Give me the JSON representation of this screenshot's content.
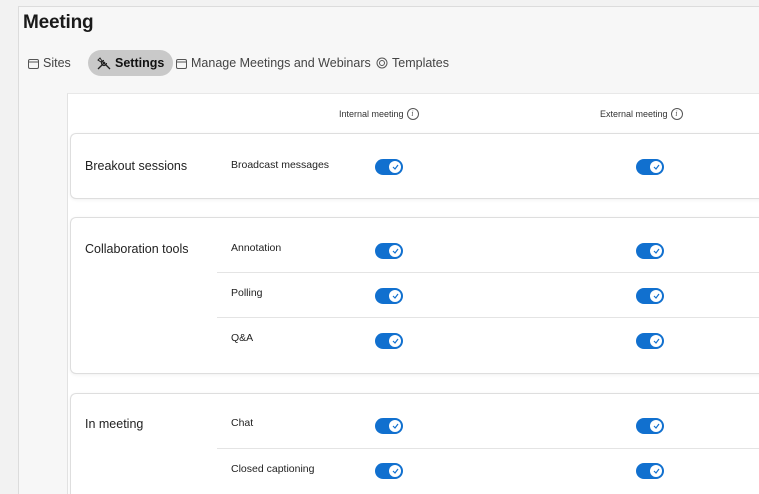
{
  "page_title": "Meeting",
  "tabs": [
    {
      "label": "Sites",
      "icon": "calendar-icon",
      "active": false
    },
    {
      "label": "Settings",
      "icon": "tools-icon",
      "active": true
    },
    {
      "label": "Manage Meetings and Webinars",
      "icon": "calendar-icon",
      "active": false
    },
    {
      "label": "Templates",
      "icon": "template-icon",
      "active": false
    }
  ],
  "columns": {
    "internal": "Internal meeting",
    "external": "External meeting"
  },
  "groups": [
    {
      "label": "Breakout sessions",
      "settings": [
        {
          "label": "Broadcast messages",
          "internal": true,
          "external": true
        }
      ]
    },
    {
      "label": "Collaboration tools",
      "settings": [
        {
          "label": "Annotation",
          "internal": true,
          "external": true
        },
        {
          "label": "Polling",
          "internal": true,
          "external": true
        },
        {
          "label": "Q&A",
          "internal": true,
          "external": true
        }
      ]
    },
    {
      "label": "In meeting",
      "settings": [
        {
          "label": "Chat",
          "internal": true,
          "external": true
        },
        {
          "label": "Closed captioning",
          "internal": true,
          "external": true
        }
      ]
    }
  ],
  "colors": {
    "toggle_on": "#1170cf",
    "active_tab_bg": "#c9c9c9"
  }
}
